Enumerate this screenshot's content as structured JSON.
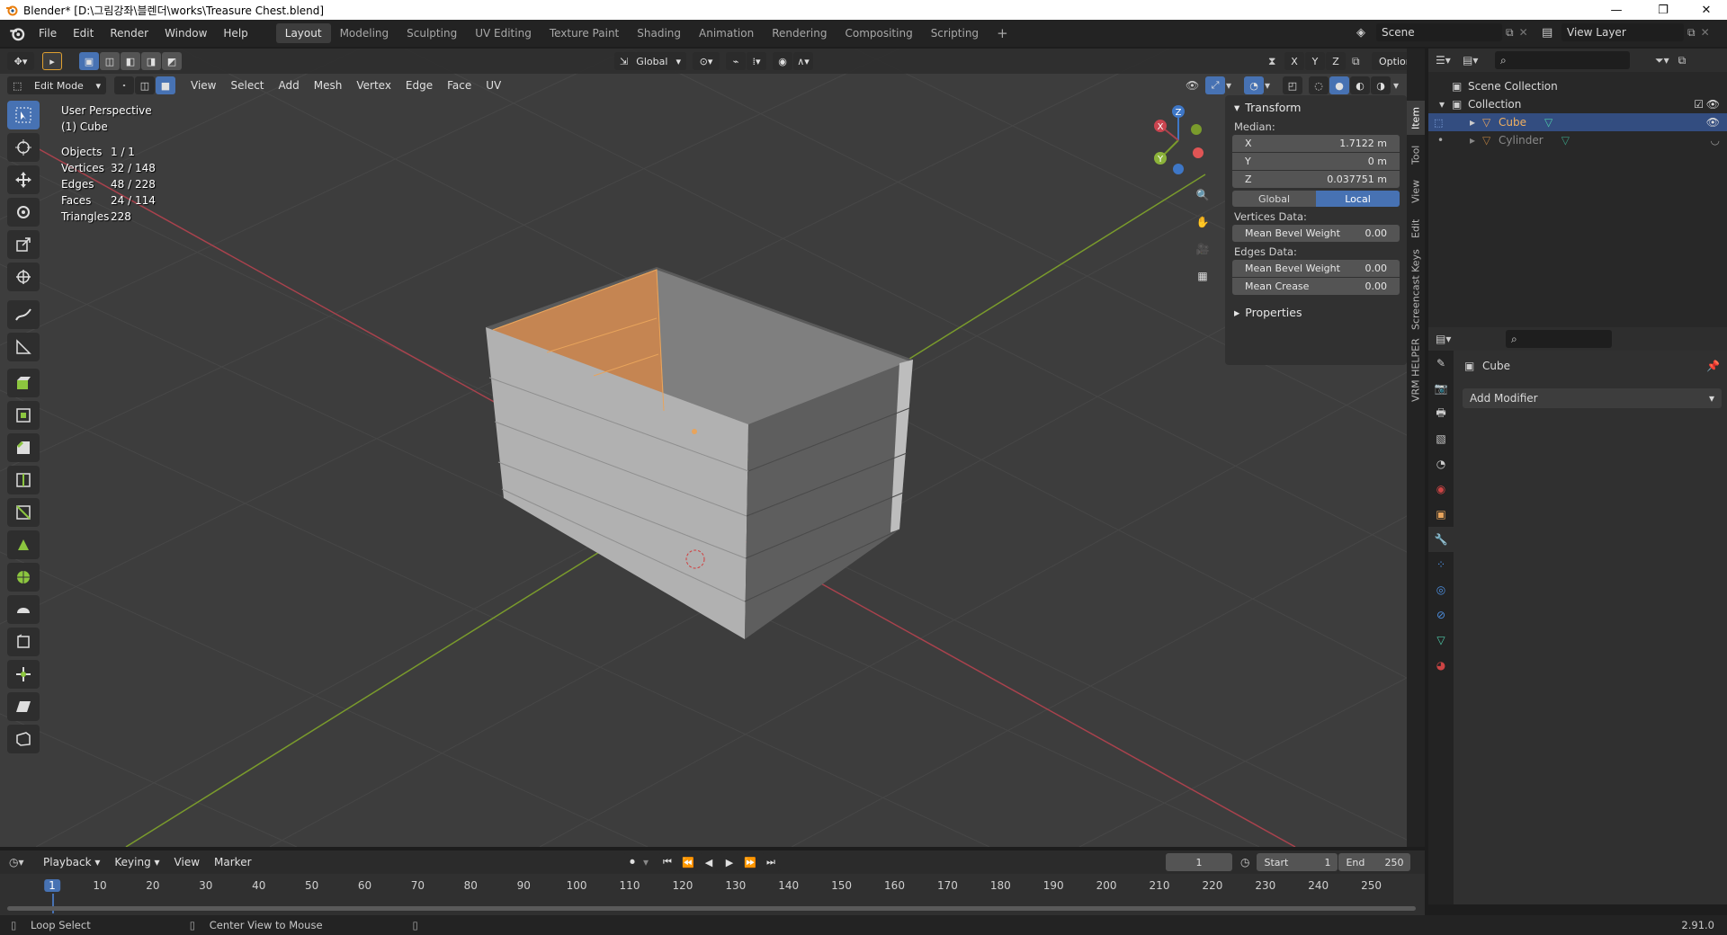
{
  "window": {
    "title": "Blender* [D:\\그림강좌\\블렌더\\works\\Treasure Chest.blend]",
    "controls": [
      "—",
      "❐",
      "✕"
    ]
  },
  "menu": [
    "File",
    "Edit",
    "Render",
    "Window",
    "Help"
  ],
  "workspaces": [
    "Layout",
    "Modeling",
    "Sculpting",
    "UV Editing",
    "Texture Paint",
    "Shading",
    "Animation",
    "Rendering",
    "Compositing",
    "Scripting"
  ],
  "active_workspace": "Layout",
  "scene": {
    "scene_name": "Scene",
    "view_layer": "View Layer"
  },
  "viewport_header": {
    "mode": "Edit Mode",
    "menus": [
      "View",
      "Select",
      "Add",
      "Mesh",
      "Vertex",
      "Edge",
      "Face",
      "UV"
    ],
    "transform_orientation": "Global",
    "axes": [
      "X",
      "Y",
      "Z"
    ],
    "options": "Options"
  },
  "viewport_info": {
    "view": "User Perspective",
    "object": "(1) Cube",
    "stats": [
      {
        "label": "Objects",
        "value": "1 / 1"
      },
      {
        "label": "Vertices",
        "value": "32 / 148"
      },
      {
        "label": "Edges",
        "value": "48 / 228"
      },
      {
        "label": "Faces",
        "value": "24 / 114"
      },
      {
        "label": "Triangles",
        "value": "228"
      }
    ]
  },
  "gizmo": {
    "x": "X",
    "y": "Y",
    "z": "Z"
  },
  "npanel": {
    "transform_title": "Transform",
    "median_label": "Median:",
    "fields": [
      {
        "label": "X",
        "value": "1.7122 m"
      },
      {
        "label": "Y",
        "value": "0 m"
      },
      {
        "label": "Z",
        "value": "0.037751 m"
      }
    ],
    "space_global": "Global",
    "space_local": "Local",
    "vertices_data": "Vertices Data:",
    "mean_bevel_weight_v": {
      "label": "Mean Bevel Weight",
      "value": "0.00"
    },
    "edges_data": "Edges Data:",
    "mean_bevel_weight_e": {
      "label": "Mean Bevel Weight",
      "value": "0.00"
    },
    "mean_crease": {
      "label": "Mean Crease",
      "value": "0.00"
    },
    "properties_title": "Properties",
    "tabs": [
      "Item",
      "Tool",
      "View",
      "Edit",
      "Screencast Keys",
      "VRM HELPER"
    ]
  },
  "outliner": {
    "scene_collection": "Scene Collection",
    "collection": "Collection",
    "items": [
      {
        "name": "Cube",
        "selected": true
      },
      {
        "name": "Cylinder",
        "selected": false
      }
    ]
  },
  "properties": {
    "object_name": "Cube",
    "add_modifier": "Add Modifier"
  },
  "timeline": {
    "menus": [
      "Playback",
      "Keying",
      "View",
      "Marker"
    ],
    "current_frame": "1",
    "start_label": "Start",
    "start": "1",
    "end_label": "End",
    "end": "250",
    "ticks": [
      "1",
      "10",
      "20",
      "30",
      "40",
      "50",
      "60",
      "70",
      "80",
      "90",
      "100",
      "110",
      "120",
      "130",
      "140",
      "150",
      "160",
      "170",
      "180",
      "190",
      "200",
      "210",
      "220",
      "230",
      "240",
      "250"
    ]
  },
  "statusbar": {
    "left": "Loop Select",
    "middle": "Center View to Mouse",
    "version": "2.91.0"
  },
  "colors": {
    "accent": "#4772b3",
    "selection": "#e8a45c",
    "x_axis": "#a9424d",
    "y_axis": "#7a9b2c",
    "z_axis": "#3e77c7"
  }
}
